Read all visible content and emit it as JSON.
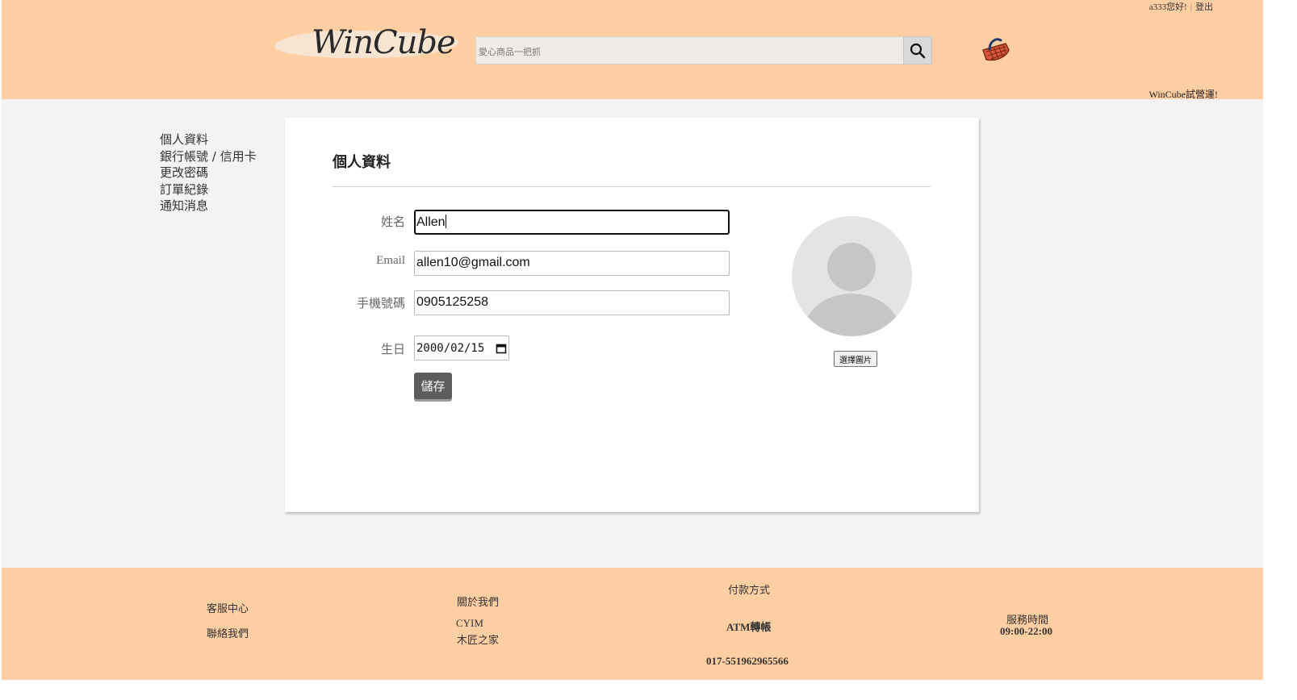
{
  "header": {
    "greeting": "a333您好!",
    "separator": "|",
    "logout": "登出",
    "logo": "WinCube",
    "search_placeholder": "愛心商品一把抓",
    "notice": "WinCube試營運!"
  },
  "sidebar": {
    "items": [
      {
        "label": "個人資料"
      },
      {
        "label": "銀行帳號 / 信用卡"
      },
      {
        "label": "更改密碼"
      },
      {
        "label": "訂單紀錄"
      },
      {
        "label": "通知消息"
      }
    ]
  },
  "profile": {
    "title": "個人資料",
    "name_label": "姓名",
    "name_value": "Allen",
    "email_label": "Email",
    "email_value": "allen10@gmail.com",
    "phone_label": "手機號碼",
    "phone_value": "0905125258",
    "birthday_label": "生日",
    "birthday_value": "2000/02/15",
    "save_label": "儲存",
    "choose_image_label": "選擇圖片"
  },
  "footer": {
    "customer_service": "客服中心",
    "contact_us": "聯絡我們",
    "about_us": "關於我們",
    "company_1": "CYIM",
    "company_2": "木匠之家",
    "payment_title": "付款方式",
    "payment_method": "ATM轉帳",
    "account_number": "017-551962965566",
    "service_hours_title": "服務時間",
    "service_hours": "09:00-22:00"
  },
  "colors": {
    "header_bg": "#ffcfa3",
    "main_bg": "#f3f3f3",
    "save_button": "#5c5c5c"
  }
}
